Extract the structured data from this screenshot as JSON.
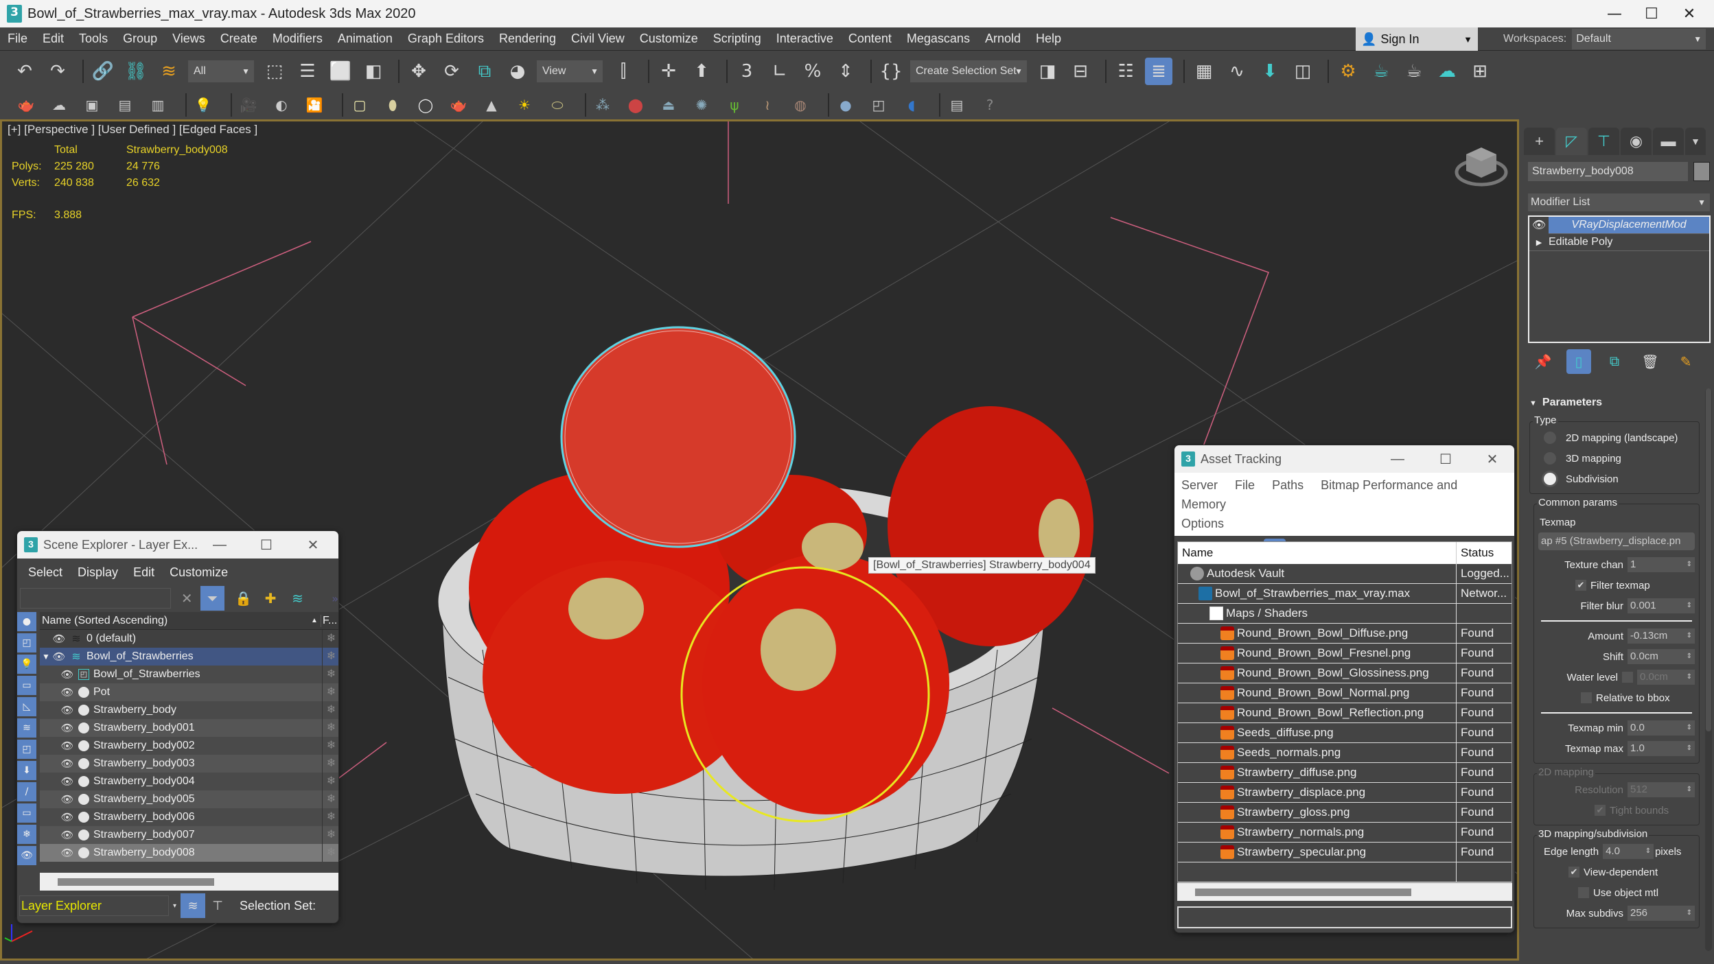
{
  "window": {
    "title": "Bowl_of_Strawberries_max_vray.max - Autodesk 3ds Max 2020",
    "app_icon": "3dsmax-logo-icon",
    "controls": [
      "minimize",
      "maximize",
      "close"
    ]
  },
  "menubar": {
    "items": [
      "File",
      "Edit",
      "Tools",
      "Group",
      "Views",
      "Create",
      "Modifiers",
      "Animation",
      "Graph Editors",
      "Rendering",
      "Civil View",
      "Customize",
      "Scripting",
      "Interactive",
      "Content",
      "Megascans",
      "Arnold",
      "Help"
    ],
    "sign_in": "Sign In",
    "workspaces_label": "Workspaces:",
    "workspaces_value": "Default"
  },
  "toolbar": {
    "selection_filter": "All",
    "reference_coord": "View",
    "selection_set_placeholder": "Create Selection Set"
  },
  "viewport": {
    "label": "[+] [Perspective ] [User Defined ] [Edged Faces ]",
    "stats": {
      "col_total": "Total",
      "col_selected": "Strawberry_body008",
      "polys_label": "Polys:",
      "polys_total": "225 280",
      "polys_selected": "24 776",
      "verts_label": "Verts:",
      "verts_total": "240 838",
      "verts_selected": "26 632",
      "fps_label": "FPS:",
      "fps_value": "3.888"
    },
    "tooltip": "[Bowl_of_Strawberries] Strawberry_body004",
    "colors": {
      "stats": "#e8d328",
      "frame": "#8a7334",
      "selection_highlight": "#e8e820",
      "active_wire": "#5fd3e3"
    }
  },
  "scene_explorer": {
    "title": "Scene Explorer - Layer Ex...",
    "menu": [
      "Select",
      "Display",
      "Edit",
      "Customize"
    ],
    "column_name": "Name (Sorted Ascending)",
    "column_frozen": "F...",
    "rows": [
      {
        "name": "0 (default)",
        "type": "layer"
      },
      {
        "name": "Bowl_of_Strawberries",
        "type": "layer-selected"
      },
      {
        "name": "Bowl_of_Strawberries",
        "type": "group"
      },
      {
        "name": "Pot",
        "type": "object"
      },
      {
        "name": "Strawberry_body",
        "type": "object"
      },
      {
        "name": "Strawberry_body001",
        "type": "object"
      },
      {
        "name": "Strawberry_body002",
        "type": "object"
      },
      {
        "name": "Strawberry_body003",
        "type": "object"
      },
      {
        "name": "Strawberry_body004",
        "type": "object"
      },
      {
        "name": "Strawberry_body005",
        "type": "object"
      },
      {
        "name": "Strawberry_body006",
        "type": "object"
      },
      {
        "name": "Strawberry_body007",
        "type": "object"
      },
      {
        "name": "Strawberry_body008",
        "type": "object-current"
      }
    ],
    "footer_mode": "Layer Explorer",
    "selection_set_label": "Selection Set:"
  },
  "asset_tracking": {
    "title": "Asset Tracking",
    "menu": [
      "Server",
      "File",
      "Paths",
      "Bitmap Performance and Memory",
      "Options"
    ],
    "col_name": "Name",
    "col_status": "Status",
    "rows": [
      {
        "name": "Autodesk Vault",
        "status": "Logged...",
        "icon": "vault",
        "indent": 1
      },
      {
        "name": "Bowl_of_Strawberries_max_vray.max",
        "status": "Networ...",
        "icon": "max",
        "indent": 2
      },
      {
        "name": "Maps / Shaders",
        "status": "",
        "icon": "maps",
        "indent": 3
      },
      {
        "name": "Round_Brown_Bowl_Diffuse.png",
        "status": "Found",
        "icon": "png",
        "indent": 4
      },
      {
        "name": "Round_Brown_Bowl_Fresnel.png",
        "status": "Found",
        "icon": "png",
        "indent": 4
      },
      {
        "name": "Round_Brown_Bowl_Glossiness.png",
        "status": "Found",
        "icon": "png",
        "indent": 4
      },
      {
        "name": "Round_Brown_Bowl_Normal.png",
        "status": "Found",
        "icon": "png",
        "indent": 4
      },
      {
        "name": "Round_Brown_Bowl_Reflection.png",
        "status": "Found",
        "icon": "png",
        "indent": 4
      },
      {
        "name": "Seeds_diffuse.png",
        "status": "Found",
        "icon": "png",
        "indent": 4
      },
      {
        "name": "Seeds_normals.png",
        "status": "Found",
        "icon": "png",
        "indent": 4
      },
      {
        "name": "Strawberry_diffuse.png",
        "status": "Found",
        "icon": "png",
        "indent": 4
      },
      {
        "name": "Strawberry_displace.png",
        "status": "Found",
        "icon": "png",
        "indent": 4
      },
      {
        "name": "Strawberry_gloss.png",
        "status": "Found",
        "icon": "png",
        "indent": 4
      },
      {
        "name": "Strawberry_normals.png",
        "status": "Found",
        "icon": "png",
        "indent": 4
      },
      {
        "name": "Strawberry_specular.png",
        "status": "Found",
        "icon": "png",
        "indent": 4
      }
    ]
  },
  "command_panel": {
    "object_name": "Strawberry_body008",
    "modifier_list": "Modifier List",
    "stack": [
      {
        "name": "VRayDisplacementMod",
        "active": true
      },
      {
        "name": "Editable Poly",
        "active": false
      }
    ],
    "parameters": {
      "title": "Parameters",
      "type_label": "Type",
      "type_options": [
        "2D mapping (landscape)",
        "3D mapping",
        "Subdivision"
      ],
      "type_selected": "Subdivision",
      "common_label": "Common params",
      "texmap_label": "Texmap",
      "texmap_value": "ap #5 (Strawberry_displace.pn",
      "texture_chan_label": "Texture chan",
      "texture_chan": "1",
      "filter_texmap_label": "Filter texmap",
      "filter_texmap": true,
      "filter_blur_label": "Filter blur",
      "filter_blur": "0.001",
      "amount_label": "Amount",
      "amount": "-0.13cm",
      "shift_label": "Shift",
      "shift": "0.0cm",
      "water_level_label": "Water level",
      "water_level": "0.0cm",
      "relative_bbox_label": "Relative to bbox",
      "relative_bbox": false,
      "texmap_min_label": "Texmap min",
      "texmap_min": "0.0",
      "texmap_max_label": "Texmap max",
      "texmap_max": "1.0",
      "mapping2d_label": "2D mapping",
      "resolution_label": "Resolution",
      "resolution": "512",
      "tight_bounds_label": "Tight bounds",
      "tight_bounds": true,
      "mapping3d_label": "3D mapping/subdivision",
      "edge_length_label": "Edge length",
      "edge_length": "4.0",
      "edge_length_unit": "pixels",
      "view_dependent_label": "View-dependent",
      "view_dependent": true,
      "use_object_mtl_label": "Use object mtl",
      "use_object_mtl": false,
      "max_subdivs_label": "Max subdivs",
      "max_subdivs": "256"
    }
  }
}
